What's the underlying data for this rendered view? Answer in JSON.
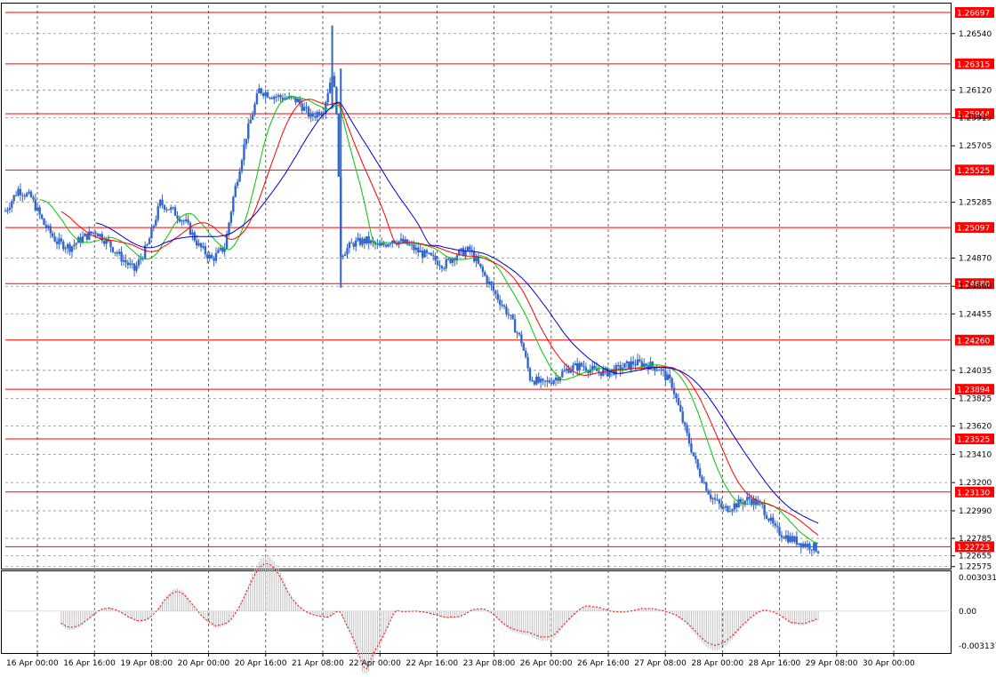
{
  "chart_data": {
    "type": "candlestick",
    "symbol_panel": {
      "y_ticks": [
        "1.26540",
        "1.26120",
        "1.25915",
        "1.25705",
        "1.25285",
        "1.24870",
        "1.24660",
        "1.24455",
        "1.24035",
        "1.23825",
        "1.23620",
        "1.23410",
        "1.23200",
        "1.22990",
        "1.22785",
        "1.22655",
        "1.22575"
      ],
      "ylim": [
        1.2256,
        1.2675
      ],
      "grid": true
    },
    "price_levels": [
      {
        "price": 1.26697,
        "label": "1.26697"
      },
      {
        "price": 1.26315,
        "label": "1.26315"
      },
      {
        "price": 1.25944,
        "label": "1.25944"
      },
      {
        "price": 1.25525,
        "label": "1.25525"
      },
      {
        "price": 1.25097,
        "label": "1.25097"
      },
      {
        "price": 1.2468,
        "label": "1.24680"
      },
      {
        "price": 1.2426,
        "label": "1.24260"
      },
      {
        "price": 1.23894,
        "label": "1.23894"
      },
      {
        "price": 1.23525,
        "label": "1.23525"
      },
      {
        "price": 1.2313,
        "label": "1.23130"
      },
      {
        "price": 1.22723,
        "label": "1.22723"
      }
    ],
    "x_ticks": [
      "16 Apr 00:00",
      "16 Apr 16:00",
      "19 Apr 08:00",
      "20 Apr 00:00",
      "20 Apr 16:00",
      "21 Apr 08:00",
      "22 Apr 00:00",
      "22 Apr 16:00",
      "23 Apr 08:00",
      "26 Apr 00:00",
      "26 Apr 16:00",
      "27 Apr 08:00",
      "28 Apr 00:00",
      "28 Apr 16:00",
      "29 Apr 08:00",
      "30 Apr 00:00"
    ],
    "close_path": [
      [
        0,
        1.2522
      ],
      [
        3,
        1.2538
      ],
      [
        6,
        1.2532
      ],
      [
        9,
        1.2512
      ],
      [
        12,
        1.2499
      ],
      [
        15,
        1.2495
      ],
      [
        18,
        1.2502
      ],
      [
        21,
        1.2507
      ],
      [
        24,
        1.2498
      ],
      [
        27,
        1.2487
      ],
      [
        30,
        1.2478
      ],
      [
        33,
        1.2496
      ],
      [
        36,
        1.2528
      ],
      [
        39,
        1.2522
      ],
      [
        42,
        1.2513
      ],
      [
        45,
        1.2496
      ],
      [
        48,
        1.2486
      ],
      [
        51,
        1.2495
      ],
      [
        53,
        1.2532
      ],
      [
        56,
        1.2578
      ],
      [
        59,
        1.2612
      ],
      [
        62,
        1.2608
      ],
      [
        65,
        1.2606
      ],
      [
        68,
        1.2604
      ],
      [
        71,
        1.2592
      ],
      [
        74,
        1.2598
      ],
      [
        76,
        1.2625
      ],
      [
        77,
        1.2598
      ],
      [
        78,
        1.249
      ],
      [
        81,
        1.2498
      ],
      [
        84,
        1.25
      ],
      [
        87,
        1.2495
      ],
      [
        90,
        1.2501
      ],
      [
        93,
        1.2498
      ],
      [
        96,
        1.2492
      ],
      [
        99,
        1.2487
      ],
      [
        102,
        1.2482
      ],
      [
        105,
        1.249
      ],
      [
        108,
        1.2493
      ],
      [
        111,
        1.2476
      ],
      [
        114,
        1.246
      ],
      [
        117,
        1.2445
      ],
      [
        120,
        1.2425
      ],
      [
        122,
        1.2398
      ],
      [
        125,
        1.2393
      ],
      [
        128,
        1.2398
      ],
      [
        131,
        1.2405
      ],
      [
        134,
        1.2407
      ],
      [
        137,
        1.2403
      ],
      [
        140,
        1.2402
      ],
      [
        143,
        1.2405
      ],
      [
        146,
        1.2409
      ],
      [
        149,
        1.2408
      ],
      [
        152,
        1.2405
      ],
      [
        155,
        1.2393
      ],
      [
        158,
        1.236
      ],
      [
        161,
        1.233
      ],
      [
        164,
        1.231
      ],
      [
        167,
        1.23
      ],
      [
        170,
        1.2304
      ],
      [
        173,
        1.2308
      ],
      [
        176,
        1.2302
      ],
      [
        179,
        1.2285
      ],
      [
        182,
        1.2279
      ],
      [
        185,
        1.2275
      ],
      [
        188,
        1.2272
      ],
      [
        189,
        1.227
      ]
    ],
    "spike_candles": [
      {
        "t": 76,
        "high": 1.266,
        "low": 1.2598
      },
      {
        "t": 78,
        "high": 1.2628,
        "low": 1.2465
      }
    ],
    "moving_averages": [
      {
        "color": "#00c800",
        "period": 8
      },
      {
        "color": "#ff0000",
        "period": 13
      },
      {
        "color": "#0000c8",
        "period": 21
      }
    ],
    "oscillator_panel": {
      "y_ticks": [
        "0.003031",
        "0.00",
        "-0.003137"
      ],
      "ylim": [
        -0.0033,
        0.0032
      ]
    },
    "colors": {
      "candle": "#3366cc",
      "level": "#ff0000",
      "level_label_bg": "#ff0000",
      "oscillator_bar": "#c0c0c0",
      "oscillator_signal": "#ff0000"
    }
  }
}
